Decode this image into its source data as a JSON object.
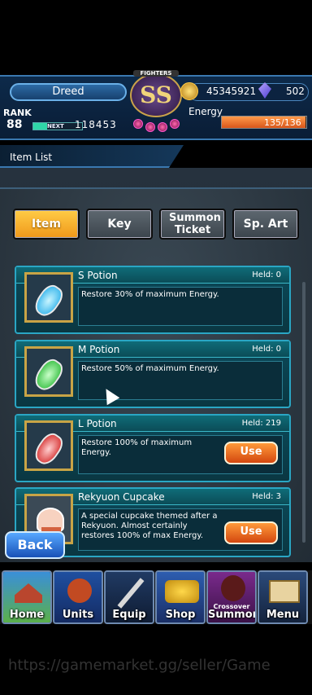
{
  "header": {
    "player_name": "Dreed",
    "rank_label": "RANK",
    "rank_value": "88",
    "next_label": "NEXT",
    "next_value": "118453",
    "exp_fraction": 0.28,
    "badge_text": "FIGHTERS",
    "badge_grade": "SS",
    "gold": "45345921",
    "crystals": "502",
    "energy_label": "Energy",
    "energy_value": "135/136",
    "energy_fraction": 0.99
  },
  "title": "Item List",
  "tabs": [
    {
      "label": "Item",
      "active": true
    },
    {
      "label": "Key",
      "active": false
    },
    {
      "label": "Summon Ticket",
      "active": false
    },
    {
      "label": "Sp. Art",
      "active": false
    }
  ],
  "items": [
    {
      "name": "S Potion",
      "held": "Held: 0",
      "desc": "Restore 30% of maximum Energy.",
      "color": "#3fd0ff",
      "use": ""
    },
    {
      "name": "M Potion",
      "held": "Held: 0",
      "desc": "Restore 50% of maximum Energy.",
      "color": "#34d84a",
      "use": ""
    },
    {
      "name": "L Potion",
      "held": "Held: 219",
      "desc": "Restore 100% of maximum Energy.",
      "color": "#e83a3a",
      "use": "Use"
    },
    {
      "name": "Rekyuon Cupcake",
      "held": "Held: 3",
      "desc": "A special cupcake themed after a Rekyuon. Almost certainly restores 100% of max Energy.",
      "color": "#f2b7a0",
      "use": "Use"
    }
  ],
  "back_label": "Back",
  "nav": [
    {
      "label": "Home",
      "icon": "house-icon"
    },
    {
      "label": "Units",
      "icon": "hero-icon"
    },
    {
      "label": "Equip",
      "icon": "sword-icon"
    },
    {
      "label": "Shop",
      "icon": "treasure-icon"
    },
    {
      "label": "Summon",
      "sub": "Crossover",
      "icon": "summon-icon"
    },
    {
      "label": "Menu",
      "icon": "book-icon"
    }
  ],
  "watermark": "https://gamemarket.gg/seller/Game"
}
